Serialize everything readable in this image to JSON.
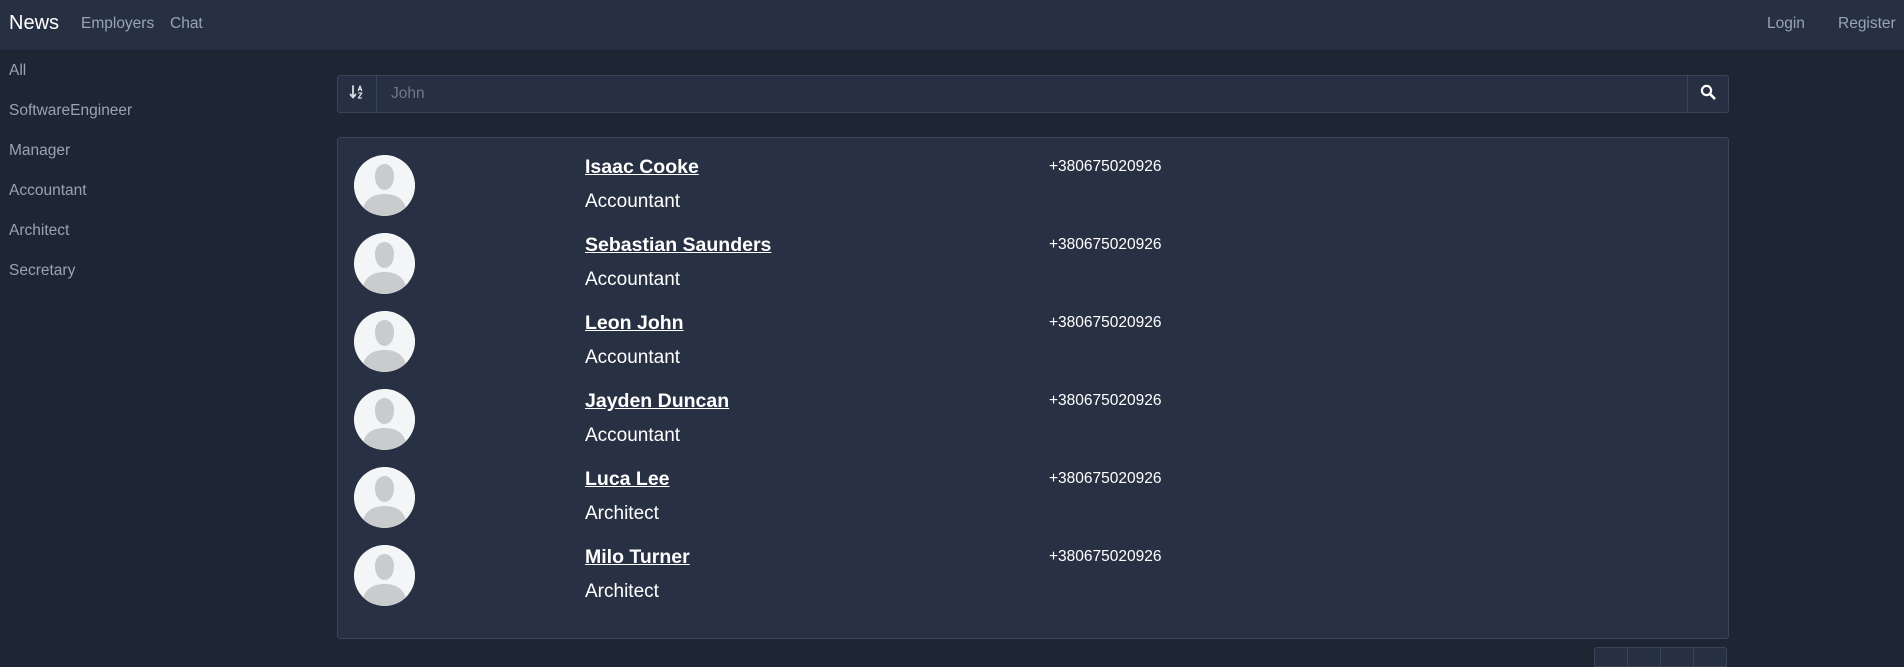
{
  "navbar": {
    "brand": "News",
    "links": [
      "Employers",
      "Chat"
    ],
    "login": "Login",
    "register": "Register"
  },
  "sidebar": {
    "items": [
      "All",
      "SoftwareEngineer",
      "Manager",
      "Accountant",
      "Architect",
      "Secretary"
    ]
  },
  "search": {
    "value": "",
    "placeholder": "John",
    "sort_icon": "sort-alpha-down-icon",
    "search_icon": "search-icon"
  },
  "employees": [
    {
      "name": "Isaac Cooke",
      "position": "Accountant",
      "phone": "+380675020926"
    },
    {
      "name": "Sebastian Saunders",
      "position": "Accountant",
      "phone": "+380675020926"
    },
    {
      "name": "Leon John",
      "position": "Accountant",
      "phone": "+380675020926"
    },
    {
      "name": "Jayden Duncan",
      "position": "Accountant",
      "phone": "+380675020926"
    },
    {
      "name": "Luca Lee",
      "position": "Architect",
      "phone": "+380675020926"
    },
    {
      "name": "Milo Turner",
      "position": "Architect",
      "phone": "+380675020926"
    }
  ],
  "colors": {
    "background": "#1e2634",
    "navbar": "#273042",
    "panel": "#283143",
    "muted_text": "#98a3b3"
  }
}
